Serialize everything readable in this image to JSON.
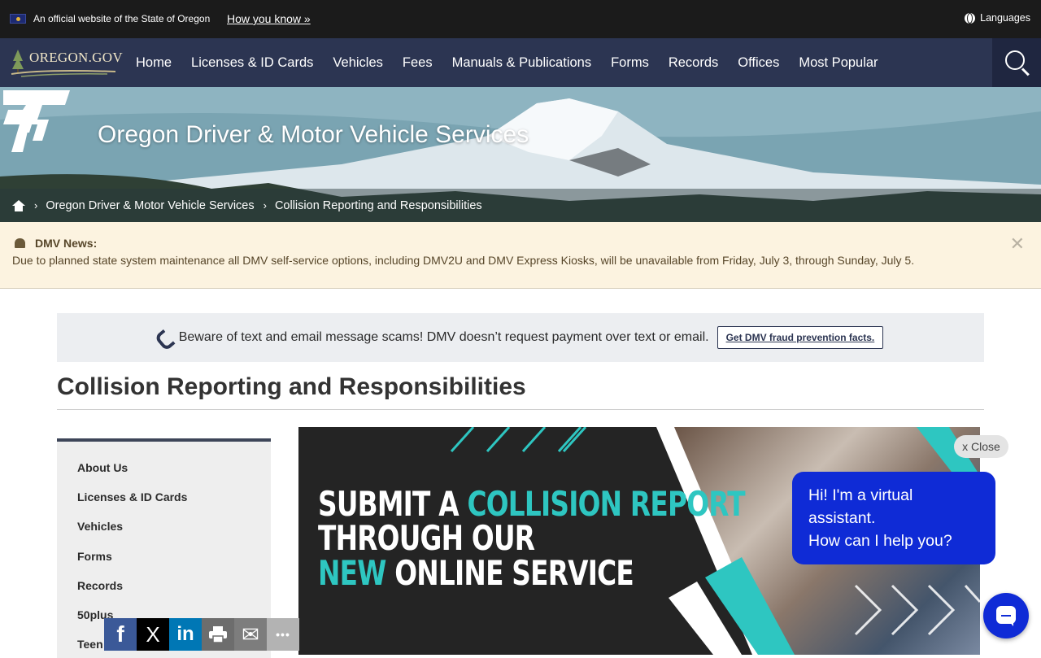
{
  "gov_banner": {
    "official_text": "An official website of the State of Oregon",
    "how_you_know": "How you know »",
    "languages": "Languages"
  },
  "nav": {
    "logo_text": "OREGON.GOV",
    "items": [
      "Home",
      "Licenses & ID Cards",
      "Vehicles",
      "Fees",
      "Manuals & Publications",
      "Forms",
      "Records",
      "Offices",
      "Most Popular"
    ]
  },
  "hero": {
    "title": "Oregon Driver & Motor Vehicle Services",
    "breadcrumb": [
      "Oregon Driver & Motor Vehicle Services",
      "Collision Reporting and Responsibilities"
    ]
  },
  "news": {
    "label": "DMV News:",
    "text": "Due to planned state system maintenance all DMV self-service options, including DMV2U and DMV Express Kiosks, will be unavailable from Friday, July 3, through Sunday, July 5.",
    "close": "✕"
  },
  "alert": {
    "text": "Beware of text and email message scams! DMV doesn’t request payment over text or email.",
    "button": "Get DMV fraud prevention facts."
  },
  "page": {
    "title": "Collision Reporting and Responsibilities"
  },
  "sidebar": {
    "items": [
      "About Us",
      "Licenses & ID Cards",
      "Vehicles",
      "Forms",
      "Records",
      "50plus",
      "Teen"
    ]
  },
  "promo": {
    "line1_a": "SUBMIT A ",
    "line1_b": "COLLISION REPORT",
    "line2": "THROUGH OUR",
    "line3_a": "NEW",
    "line3_b": " ONLINE SERVICE"
  },
  "chat": {
    "close": "x Close",
    "line1": "Hi! I'm a virtual assistant.",
    "line2": "How can I help you?"
  },
  "share": {
    "facebook": "f",
    "x": "X",
    "linkedin": "in",
    "email": "✉",
    "more": "•••",
    "colors": {
      "facebook": "#3b5998",
      "x": "#000000",
      "linkedin": "#0077b5",
      "print": "#6d6d6d",
      "email": "#7d7d7d",
      "more": "#b3b3b3"
    }
  },
  "colors": {
    "nav_bg": "#2c3552",
    "accent_teal": "#2ec6c1",
    "chat_blue": "#0f2bd6",
    "news_bg": "#fcf3e0"
  }
}
